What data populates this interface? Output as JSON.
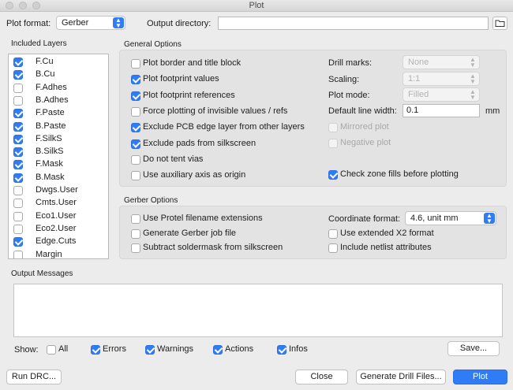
{
  "window": {
    "title": "Plot"
  },
  "top": {
    "plot_format_label": "Plot format:",
    "plot_format_value": "Gerber",
    "output_directory_label": "Output directory:",
    "output_directory_value": ""
  },
  "layers": {
    "title": "Included Layers",
    "items": [
      {
        "label": "F.Cu",
        "checked": true
      },
      {
        "label": "B.Cu",
        "checked": true
      },
      {
        "label": "F.Adhes",
        "checked": false
      },
      {
        "label": "B.Adhes",
        "checked": false
      },
      {
        "label": "F.Paste",
        "checked": true
      },
      {
        "label": "B.Paste",
        "checked": true
      },
      {
        "label": "F.SilkS",
        "checked": true
      },
      {
        "label": "B.SilkS",
        "checked": true
      },
      {
        "label": "F.Mask",
        "checked": true
      },
      {
        "label": "B.Mask",
        "checked": true
      },
      {
        "label": "Dwgs.User",
        "checked": false
      },
      {
        "label": "Cmts.User",
        "checked": false
      },
      {
        "label": "Eco1.User",
        "checked": false
      },
      {
        "label": "Eco2.User",
        "checked": false
      },
      {
        "label": "Edge.Cuts",
        "checked": true
      },
      {
        "label": "Margin",
        "checked": false
      }
    ]
  },
  "general": {
    "title": "General Options",
    "checks": [
      {
        "label": "Plot border and title block",
        "checked": false
      },
      {
        "label": "Plot footprint values",
        "checked": true
      },
      {
        "label": "Plot footprint references",
        "checked": true
      },
      {
        "label": "Force plotting of invisible values / refs",
        "checked": false
      },
      {
        "label": "Exclude PCB edge layer from other layers",
        "checked": true
      },
      {
        "label": "Exclude pads from silkscreen",
        "checked": true
      },
      {
        "label": "Do not tent vias",
        "checked": false
      },
      {
        "label": "Use auxiliary axis as origin",
        "checked": false
      }
    ],
    "drill_marks_label": "Drill marks:",
    "drill_marks_value": "None",
    "scaling_label": "Scaling:",
    "scaling_value": "1:1",
    "plot_mode_label": "Plot mode:",
    "plot_mode_value": "Filled",
    "line_width_label": "Default line width:",
    "line_width_value": "0.1",
    "line_width_unit": "mm",
    "mirrored_label": "Mirrored plot",
    "negative_label": "Negative plot",
    "zone_fills_label": "Check zone fills before plotting",
    "zone_fills_checked": true
  },
  "gerber": {
    "title": "Gerber Options",
    "checks": [
      {
        "label": "Use Protel filename extensions",
        "checked": false
      },
      {
        "label": "Generate Gerber job file",
        "checked": false
      },
      {
        "label": "Subtract soldermask from silkscreen",
        "checked": false
      }
    ],
    "coord_format_label": "Coordinate format:",
    "coord_format_value": "4.6, unit mm",
    "x2_label": "Use extended X2 format",
    "netlist_label": "Include netlist attributes"
  },
  "messages": {
    "title": "Output Messages",
    "show_label": "Show:",
    "filters": [
      {
        "label": "All",
        "checked": false
      },
      {
        "label": "Errors",
        "checked": true
      },
      {
        "label": "Warnings",
        "checked": true
      },
      {
        "label": "Actions",
        "checked": true
      },
      {
        "label": "Infos",
        "checked": true
      }
    ],
    "save_label": "Save..."
  },
  "footer": {
    "run_drc": "Run DRC...",
    "close": "Close",
    "drill_files": "Generate Drill Files...",
    "plot": "Plot"
  },
  "colors": {
    "accent": "#2f7cf6",
    "panel": "#e3e3e3",
    "window": "#ececec"
  },
  "icons": {
    "folder": "folder-icon",
    "caret": "updown-caret-icon"
  }
}
